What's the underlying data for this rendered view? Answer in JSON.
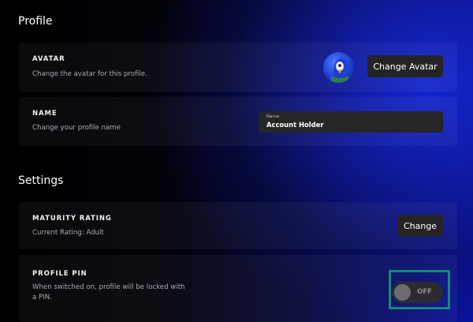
{
  "profile": {
    "heading": "Profile",
    "avatar": {
      "label": "AVATAR",
      "description": "Change the avatar for this profile.",
      "button": "Change Avatar",
      "icon": "bird-avatar-icon"
    },
    "name": {
      "label": "NAME",
      "description": "Change your profile name",
      "field_label": "Name",
      "field_value": "Account Holder"
    }
  },
  "settings": {
    "heading": "Settings",
    "maturity": {
      "label": "MATURITY RATING",
      "description": "Current Rating: Adult",
      "button": "Change"
    },
    "pin": {
      "label": "PROFILE PIN",
      "description_line1": "When switched on, profile will be locked with",
      "description_line2": "a PIN.",
      "toggle_state": "OFF",
      "focus_color": "#17877d"
    }
  }
}
